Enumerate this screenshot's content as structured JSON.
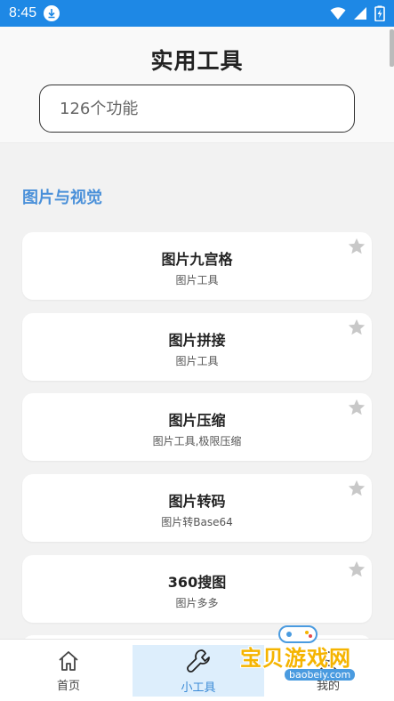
{
  "status_bar": {
    "time": "8:45"
  },
  "header": {
    "title": "实用工具",
    "search": {
      "placeholder": "126个功能",
      "value": ""
    }
  },
  "section": {
    "title": "图片与视觉"
  },
  "cards": [
    {
      "title": "图片九宫格",
      "subtitle": "图片工具"
    },
    {
      "title": "图片拼接",
      "subtitle": "图片工具"
    },
    {
      "title": "图片压缩",
      "subtitle": "图片工具,极限压缩"
    },
    {
      "title": "图片转码",
      "subtitle": "图片转Base64"
    },
    {
      "title": "360搜图",
      "subtitle": "图片多多"
    }
  ],
  "bottom_nav": {
    "items": [
      {
        "label": "首页",
        "icon": "home-icon"
      },
      {
        "label": "小工具",
        "icon": "wrench-icon",
        "active": true
      },
      {
        "label": "我的",
        "icon": "person-icon"
      }
    ]
  },
  "watermark": {
    "text": "宝贝游戏网",
    "url": "baobeiy.com"
  },
  "colors": {
    "status_bar": "#1e88e5",
    "accent": "#4a90d9",
    "star": "#c8c8c8",
    "active_tab_bg": "#ddeefc"
  }
}
